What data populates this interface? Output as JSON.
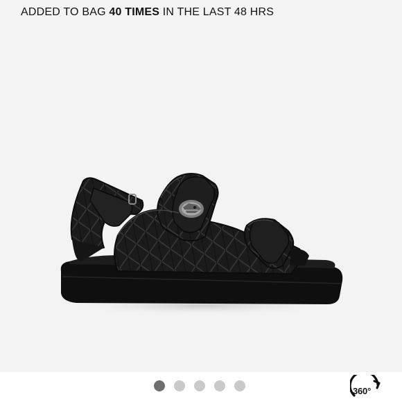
{
  "banner": {
    "prefix": "ADDED TO BAG ",
    "count_text": "40 TIMES",
    "suffix": " IN THE LAST 48 HRS"
  },
  "product_image": {
    "alt": "Black quilted leather two-strap sandal with silver eagle-head embellishment"
  },
  "carousel": {
    "total": 5,
    "active_index": 1,
    "dots": [
      {
        "label": "1",
        "active": true
      },
      {
        "label": "2",
        "active": false
      },
      {
        "label": "3",
        "active": false
      },
      {
        "label": "4",
        "active": false
      },
      {
        "label": "5",
        "active": false
      }
    ]
  },
  "view360": {
    "label": "360°"
  },
  "colors": {
    "active_dot": "#6f6f6f",
    "inactive_dot": "#c9c9c9",
    "text": "#111111",
    "photo_bg": "#f3f3f3"
  }
}
